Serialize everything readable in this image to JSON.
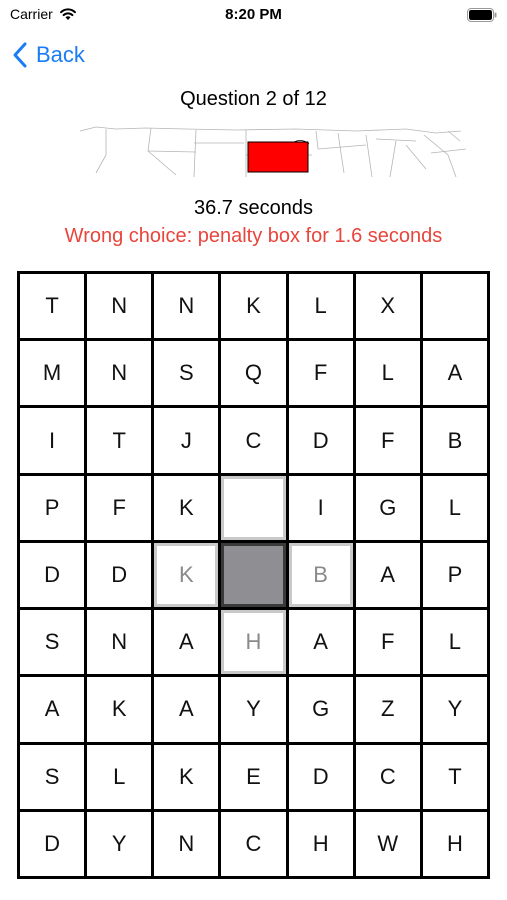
{
  "status_bar": {
    "carrier": "Carrier",
    "time": "8:20 PM"
  },
  "nav": {
    "back_label": "Back",
    "accent": "#1a7cf5"
  },
  "question": {
    "title": "Question 2 of 12",
    "highlight_color": "#ff0000"
  },
  "timer": {
    "text": "36.7 seconds"
  },
  "penalty": {
    "text": "Wrong choice: penalty box for 1.6 seconds",
    "color": "#e8453c"
  },
  "board": {
    "rows": [
      [
        {
          "l": "T"
        },
        {
          "l": "N"
        },
        {
          "l": "N"
        },
        {
          "l": "K"
        },
        {
          "l": "L"
        },
        {
          "l": "X"
        },
        {
          "l": ""
        }
      ],
      [
        {
          "l": "M"
        },
        {
          "l": "N"
        },
        {
          "l": "S"
        },
        {
          "l": "Q"
        },
        {
          "l": "F"
        },
        {
          "l": "L"
        },
        {
          "l": "A"
        }
      ],
      [
        {
          "l": "I"
        },
        {
          "l": "T"
        },
        {
          "l": "J"
        },
        {
          "l": "C"
        },
        {
          "l": "D"
        },
        {
          "l": "F"
        },
        {
          "l": "B"
        }
      ],
      [
        {
          "l": "P"
        },
        {
          "l": "F"
        },
        {
          "l": "K"
        },
        {
          "l": "",
          "s": "gap"
        },
        {
          "l": "I"
        },
        {
          "l": "G"
        },
        {
          "l": "L"
        }
      ],
      [
        {
          "l": "D"
        },
        {
          "l": "D"
        },
        {
          "l": "K",
          "s": "faded"
        },
        {
          "l": "",
          "s": "selected"
        },
        {
          "l": "B",
          "s": "faded"
        },
        {
          "l": "A"
        },
        {
          "l": "P"
        }
      ],
      [
        {
          "l": "S"
        },
        {
          "l": "N"
        },
        {
          "l": "A"
        },
        {
          "l": "H",
          "s": "faded"
        },
        {
          "l": "A"
        },
        {
          "l": "F"
        },
        {
          "l": "L"
        }
      ],
      [
        {
          "l": "A"
        },
        {
          "l": "K"
        },
        {
          "l": "A"
        },
        {
          "l": "Y"
        },
        {
          "l": "G"
        },
        {
          "l": "Z"
        },
        {
          "l": "Y"
        }
      ],
      [
        {
          "l": "S"
        },
        {
          "l": "L"
        },
        {
          "l": "K"
        },
        {
          "l": "E"
        },
        {
          "l": "D"
        },
        {
          "l": "C"
        },
        {
          "l": "T"
        }
      ],
      [
        {
          "l": "D"
        },
        {
          "l": "Y"
        },
        {
          "l": "N"
        },
        {
          "l": "C"
        },
        {
          "l": "H"
        },
        {
          "l": "W"
        },
        {
          "l": "H"
        }
      ]
    ]
  }
}
